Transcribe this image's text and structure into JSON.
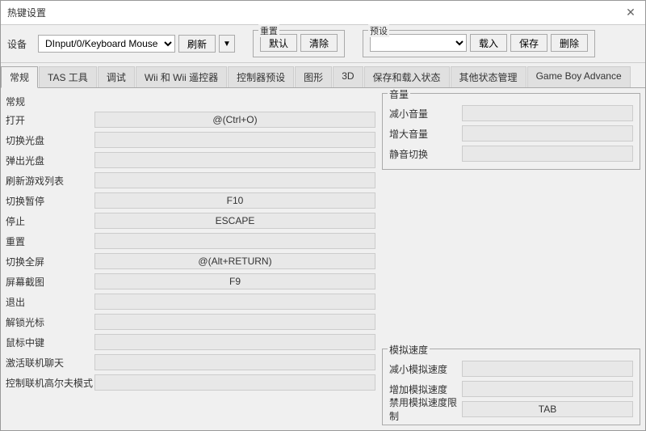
{
  "window": {
    "title": "热键设置",
    "close_button": "✕"
  },
  "toolbar": {
    "device_label": "设备",
    "device_options": [
      "DInput/0/Keyboard Mouse"
    ],
    "device_selected": "DInput/0/Keyboard Mouse",
    "refresh_label": "刷新",
    "arrow_label": "▼",
    "reset_group_label": "重置",
    "default_label": "默认",
    "clear_label": "清除",
    "preset_group_label": "预设",
    "preset_selected": "",
    "load_label": "载入",
    "save_label": "保存",
    "delete_label": "删除"
  },
  "tabs": [
    {
      "label": "常规",
      "active": true
    },
    {
      "label": "TAS 工具",
      "active": false
    },
    {
      "label": "调试",
      "active": false
    },
    {
      "label": "Wii 和 Wii 遥控器",
      "active": false
    },
    {
      "label": "控制器预设",
      "active": false
    },
    {
      "label": "图形",
      "active": false
    },
    {
      "label": "3D",
      "active": false
    },
    {
      "label": "保存和载入状态",
      "active": false
    },
    {
      "label": "其他状态管理",
      "active": false
    },
    {
      "label": "Game Boy Advance",
      "active": false
    }
  ],
  "left_section_title": "常规",
  "hotkeys": [
    {
      "label": "打开",
      "value": "@(Ctrl+O)"
    },
    {
      "label": "切换光盘",
      "value": ""
    },
    {
      "label": "弹出光盘",
      "value": ""
    },
    {
      "label": "刷新游戏列表",
      "value": ""
    },
    {
      "label": "切换暂停",
      "value": "F10"
    },
    {
      "label": "停止",
      "value": "ESCAPE"
    },
    {
      "label": "重置",
      "value": ""
    },
    {
      "label": "切换全屏",
      "value": "@(Alt+RETURN)"
    },
    {
      "label": "屏幕截图",
      "value": "F9"
    },
    {
      "label": "退出",
      "value": ""
    },
    {
      "label": "解锁光标",
      "value": ""
    },
    {
      "label": "鼠标中键",
      "value": ""
    },
    {
      "label": "激活联机聊天",
      "value": ""
    },
    {
      "label": "控制联机高尔夫模式",
      "value": ""
    }
  ],
  "right_volume_title": "音量",
  "volume_hotkeys": [
    {
      "label": "减小音量",
      "value": ""
    },
    {
      "label": "增大音量",
      "value": ""
    },
    {
      "label": "静音切换",
      "value": ""
    }
  ],
  "right_speed_title": "模拟速度",
  "speed_hotkeys": [
    {
      "label": "减小模拟速度",
      "value": ""
    },
    {
      "label": "增加模拟速度",
      "value": ""
    },
    {
      "label": "禁用模拟速度限制",
      "value": "TAB"
    }
  ]
}
